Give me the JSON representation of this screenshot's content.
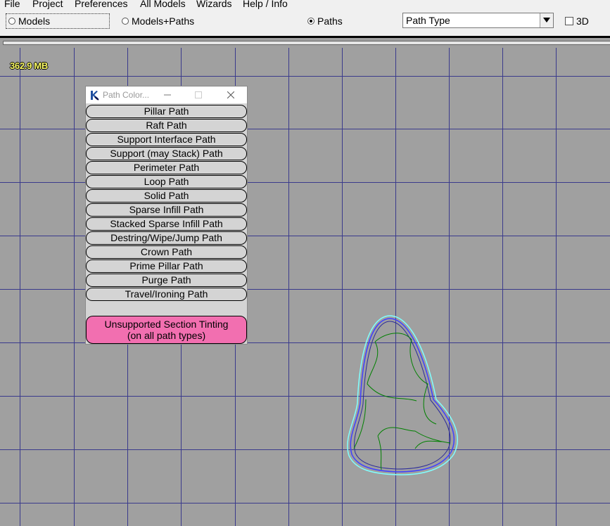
{
  "menu": [
    "File",
    "Project",
    "Preferences",
    "All Models",
    "Wizards",
    "Help / Info"
  ],
  "toolbar": {
    "view_modes": [
      {
        "label": "Models",
        "checked": false
      },
      {
        "label": "Models+Paths",
        "checked": false
      },
      {
        "label": "Paths",
        "checked": true
      }
    ],
    "color_mode_select": {
      "selected": "Path Type"
    },
    "checkbox_3d": {
      "label": "3D",
      "checked": false
    }
  },
  "viewport": {
    "memory_usage": "362.9 MB",
    "background_color": "#a0a0a0",
    "grid_color": "#3a3a8c"
  },
  "path_color_window": {
    "title": "Path Color...",
    "paths": [
      {
        "label": "Pillar Path",
        "bg": "#ff0000",
        "fg": "#ffffff"
      },
      {
        "label": "Raft Path",
        "bg": "#ff0000",
        "fg": "#ffffff"
      },
      {
        "label": "Support Interface Path",
        "bg": "#c8c8c8",
        "fg": "#000000"
      },
      {
        "label": "Support (may Stack) Path",
        "bg": "#808080",
        "fg": "#000000"
      },
      {
        "label": "Perimeter Path",
        "bg": "#80ffff",
        "fg": "#000000"
      },
      {
        "label": "Loop Path",
        "bg": "#4040ff",
        "fg": "#ffffff"
      },
      {
        "label": "Solid Path",
        "bg": "#000080",
        "fg": "#ffffff"
      },
      {
        "label": "Sparse Infill Path",
        "bg": "#00ff00",
        "fg": "#008000"
      },
      {
        "label": "Stacked Sparse Infill Path",
        "bg": "#008000",
        "fg": "#ffffff"
      },
      {
        "label": "Destring/Wipe/Jump Path",
        "bg": "#ffb000",
        "fg": "#000000"
      },
      {
        "label": "Crown Path",
        "bg": "#ff40ff",
        "fg": "#000000"
      },
      {
        "label": "Prime Pillar Path",
        "bg": "#9030c8",
        "fg": "#ffffff"
      },
      {
        "label": "Purge Path",
        "bg": "#20b060",
        "fg": "#000000"
      },
      {
        "label": "Travel/Ironing Path",
        "bg": "#ffffff",
        "fg": "#000000"
      }
    ],
    "unsupported_line1": "Unsupported Section Tinting",
    "unsupported_line2": "(on all path types)"
  }
}
